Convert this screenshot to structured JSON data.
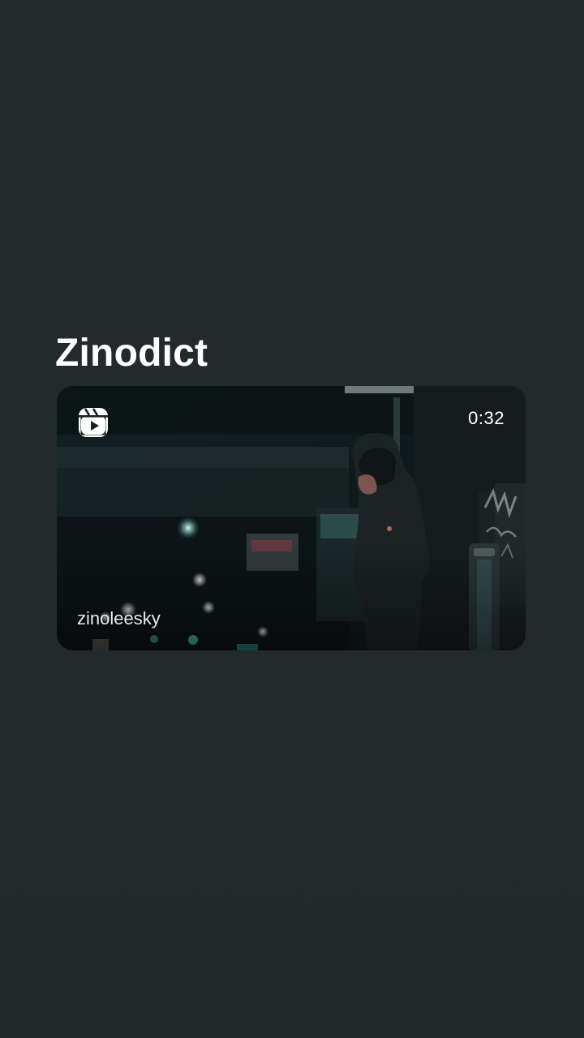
{
  "post": {
    "author_title": "Zinodict",
    "reel": {
      "username": "zinoleesky",
      "duration": "0:32",
      "type_icon": "reels-icon"
    }
  },
  "colors": {
    "background": "#232a2c",
    "text": "#ffffff"
  }
}
